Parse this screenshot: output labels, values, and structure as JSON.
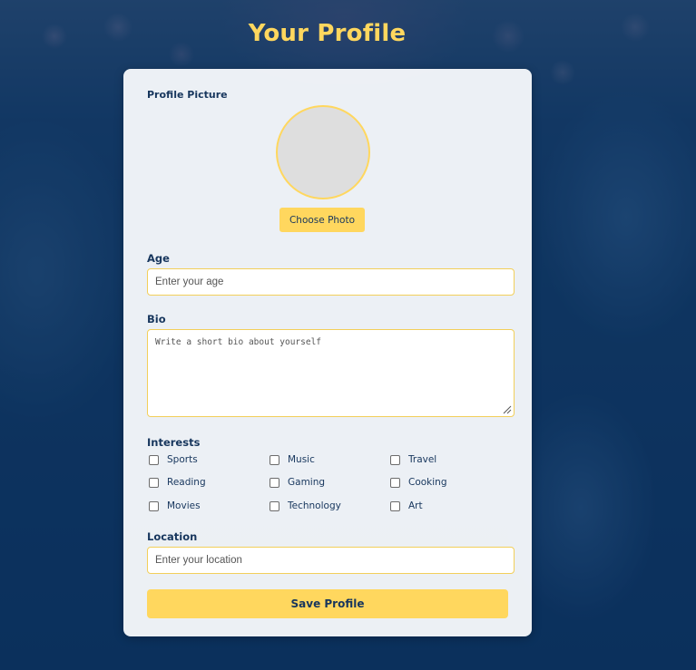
{
  "page": {
    "title": "Your Profile"
  },
  "profile_picture": {
    "label": "Profile Picture",
    "choose_button": "Choose Photo"
  },
  "age": {
    "label": "Age",
    "placeholder": "Enter your age",
    "value": ""
  },
  "bio": {
    "label": "Bio",
    "placeholder": "Write a short bio about yourself",
    "value": ""
  },
  "interests": {
    "label": "Interests",
    "options": [
      {
        "label": "Sports",
        "checked": false
      },
      {
        "label": "Music",
        "checked": false
      },
      {
        "label": "Travel",
        "checked": false
      },
      {
        "label": "Reading",
        "checked": false
      },
      {
        "label": "Gaming",
        "checked": false
      },
      {
        "label": "Cooking",
        "checked": false
      },
      {
        "label": "Movies",
        "checked": false
      },
      {
        "label": "Technology",
        "checked": false
      },
      {
        "label": "Art",
        "checked": false
      }
    ]
  },
  "location": {
    "label": "Location",
    "placeholder": "Enter your location",
    "value": ""
  },
  "actions": {
    "save_button": "Save Profile"
  },
  "colors": {
    "accent": "#ffd75e",
    "text_primary": "#17365d",
    "background_overlay": "#0f3560",
    "card_background": "#f6f8fb"
  }
}
